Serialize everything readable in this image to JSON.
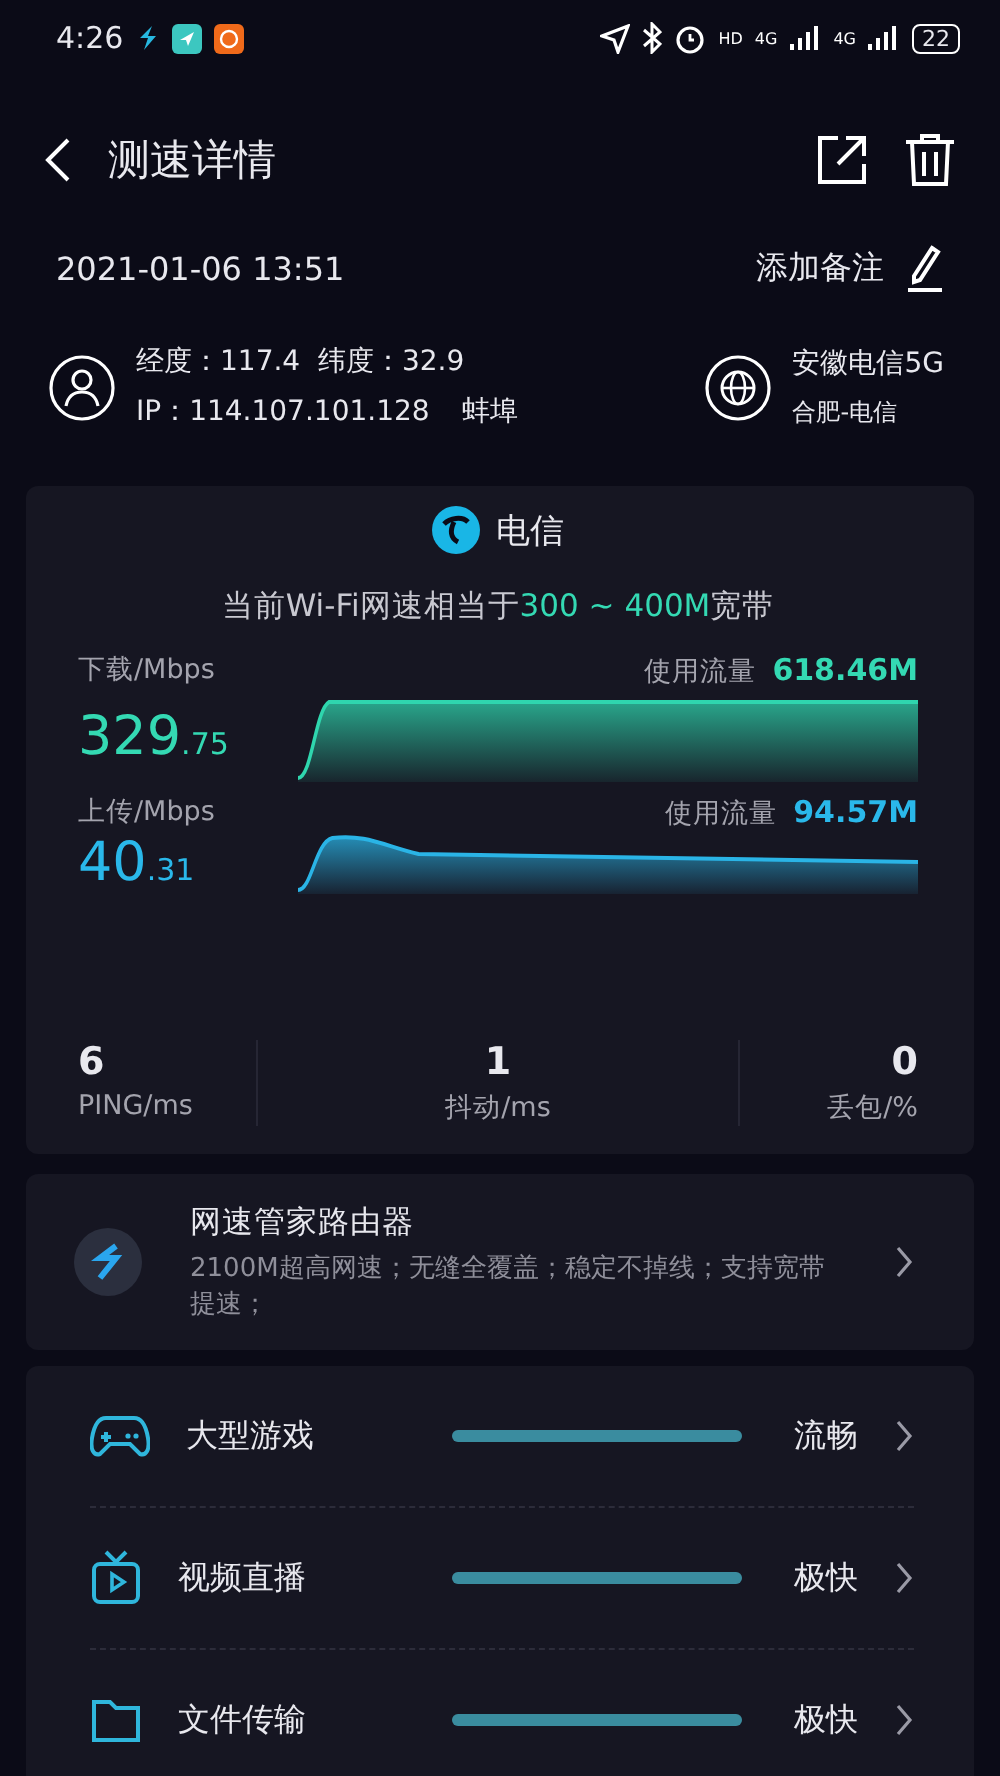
{
  "status_bar": {
    "time": "4:26",
    "network_labels": [
      "HD",
      "4G",
      "4G"
    ],
    "battery": "22"
  },
  "header": {
    "title": "测速详情"
  },
  "test": {
    "datetime": "2021-01-06 13:51",
    "note_action": "添加备注",
    "location": "经度：117.4  纬度：32.9",
    "ip": "IP：114.107.101.128",
    "city": "蚌埠",
    "carrier": "安徽电信5G",
    "region": "合肥-电信"
  },
  "result": {
    "provider": "电信",
    "summary": "当前Wi-Fi网速相当于",
    "summary_highlight": "300 ~ 400M",
    "summary_suffix": "宽带",
    "speeds": [
      {
        "kind": "download",
        "label": "下载/Mbps",
        "value_main": "329",
        "value_fraction": ".75",
        "usage_label": "使用流量",
        "usage": "618.46M"
      },
      {
        "kind": "upload",
        "label": "上传/Mbps",
        "value_main": "40",
        "value_fraction": ".31",
        "usage_label": "使用流量",
        "usage": "94.57M"
      }
    ],
    "stats": [
      {
        "value": "6",
        "label": "PING/ms"
      },
      {
        "value": "1",
        "label": "抖动/ms"
      },
      {
        "value": "0",
        "label": "丢包/%"
      }
    ]
  },
  "ad": {
    "title": "网速管家路由器",
    "description": "2100M超高网速；无缝全覆盖；稳定不掉线；支持宽带提速；"
  },
  "ratings": [
    {
      "kind": "game",
      "name": "大型游戏",
      "level": 1,
      "rating": "流畅"
    },
    {
      "kind": "video",
      "name": "视频直播",
      "level": 1,
      "rating": "极快"
    },
    {
      "kind": "file",
      "name": "文件传输",
      "level": 1,
      "rating": "极快"
    }
  ]
}
